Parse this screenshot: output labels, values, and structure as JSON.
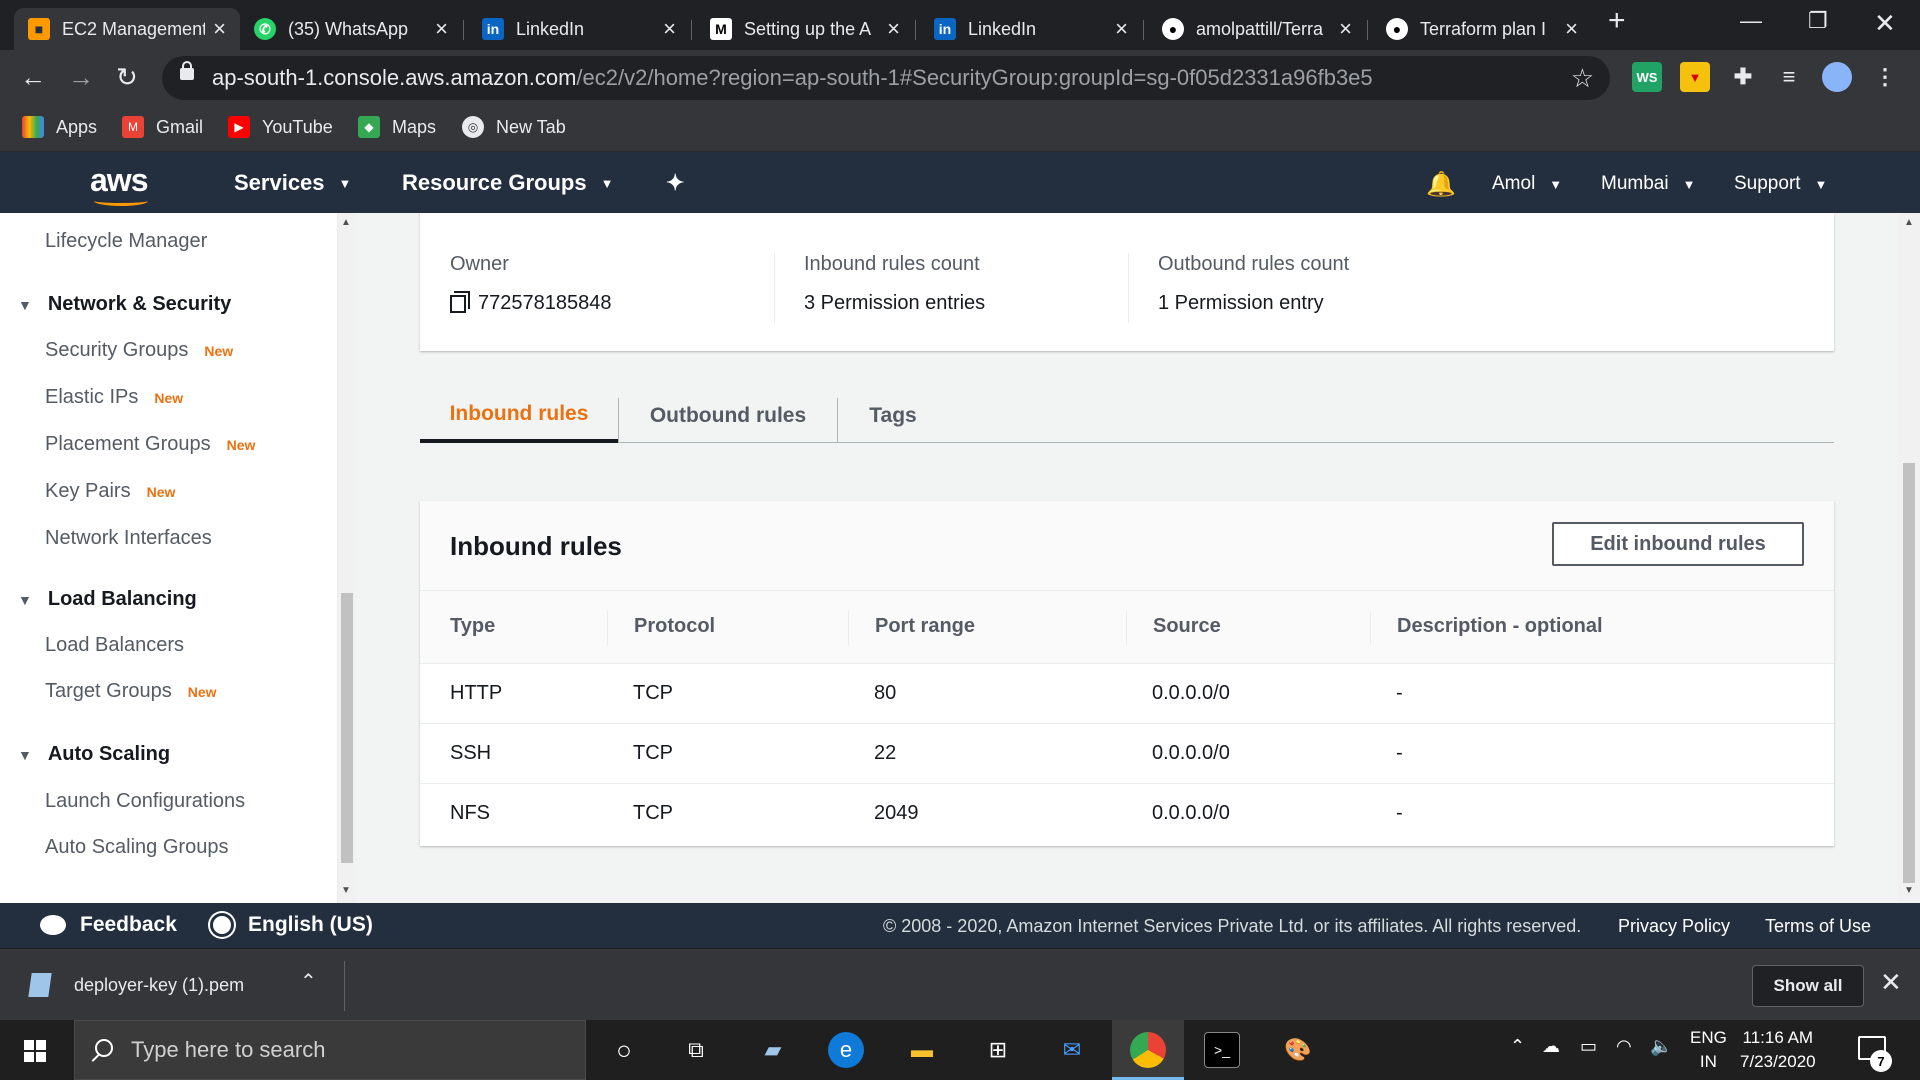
{
  "browser": {
    "tabs": [
      {
        "title": "EC2 Management",
        "icon": "aws-cube-icon",
        "active": true
      },
      {
        "title": "(35) WhatsApp",
        "icon": "whatsapp-icon"
      },
      {
        "title": "LinkedIn",
        "icon": "linkedin-icon"
      },
      {
        "title": "Setting up the A",
        "icon": "medium-icon"
      },
      {
        "title": "LinkedIn",
        "icon": "linkedin-icon"
      },
      {
        "title": "amolpattill/Terra",
        "icon": "github-icon"
      },
      {
        "title": "Terraform plan I",
        "icon": "github-icon"
      }
    ],
    "url_host": "ap-south-1.console.aws.amazon.com",
    "url_path": "/ec2/v2/home?region=ap-south-1#SecurityGroup:groupId=sg-0f05d2331a96fb3e5",
    "bookmarks": [
      "Apps",
      "Gmail",
      "YouTube",
      "Maps",
      "New Tab"
    ],
    "extension_ws_label": "WS"
  },
  "aws_nav": {
    "logo": "aws",
    "services": "Services",
    "resource_groups": "Resource Groups",
    "user": "Amol",
    "region": "Mumbai",
    "support": "Support"
  },
  "sidebar": {
    "top_link": "Lifecycle Manager",
    "sections": [
      {
        "title": "Network & Security",
        "items": [
          {
            "label": "Security Groups",
            "badge": "New"
          },
          {
            "label": "Elastic IPs",
            "badge": "New"
          },
          {
            "label": "Placement Groups",
            "badge": "New"
          },
          {
            "label": "Key Pairs",
            "badge": "New"
          },
          {
            "label": "Network Interfaces",
            "badge": ""
          }
        ]
      },
      {
        "title": "Load Balancing",
        "items": [
          {
            "label": "Load Balancers",
            "badge": ""
          },
          {
            "label": "Target Groups",
            "badge": "New"
          }
        ]
      },
      {
        "title": "Auto Scaling",
        "items": [
          {
            "label": "Launch Configurations",
            "badge": ""
          },
          {
            "label": "Auto Scaling Groups",
            "badge": ""
          }
        ]
      }
    ]
  },
  "details": {
    "owner_label": "Owner",
    "owner_value": "772578185848",
    "inbound_label": "Inbound rules count",
    "inbound_value": "3 Permission entries",
    "outbound_label": "Outbound rules count",
    "outbound_value": "1 Permission entry"
  },
  "tabs": {
    "inbound": "Inbound rules",
    "outbound": "Outbound rules",
    "tags": "Tags",
    "active": "inbound"
  },
  "rules": {
    "title": "Inbound rules",
    "edit_button": "Edit inbound rules",
    "columns": [
      "Type",
      "Protocol",
      "Port range",
      "Source",
      "Description - optional"
    ],
    "rows": [
      [
        "HTTP",
        "TCP",
        "80",
        "0.0.0.0/0",
        "-"
      ],
      [
        "SSH",
        "TCP",
        "22",
        "0.0.0.0/0",
        "-"
      ],
      [
        "NFS",
        "TCP",
        "2049",
        "0.0.0.0/0",
        "-"
      ]
    ]
  },
  "footer": {
    "feedback": "Feedback",
    "language": "English (US)",
    "copyright": "© 2008 - 2020, Amazon Internet Services Private Ltd. or its affiliates. All rights reserved.",
    "privacy": "Privacy Policy",
    "terms": "Terms of Use"
  },
  "downloads": {
    "file": "deployer-key (1).pem",
    "show_all": "Show all"
  },
  "taskbar": {
    "search_placeholder": "Type here to search",
    "lang_line1": "ENG",
    "lang_line2": "IN",
    "time": "11:16 AM",
    "date": "7/23/2020",
    "notification_count": "7"
  }
}
